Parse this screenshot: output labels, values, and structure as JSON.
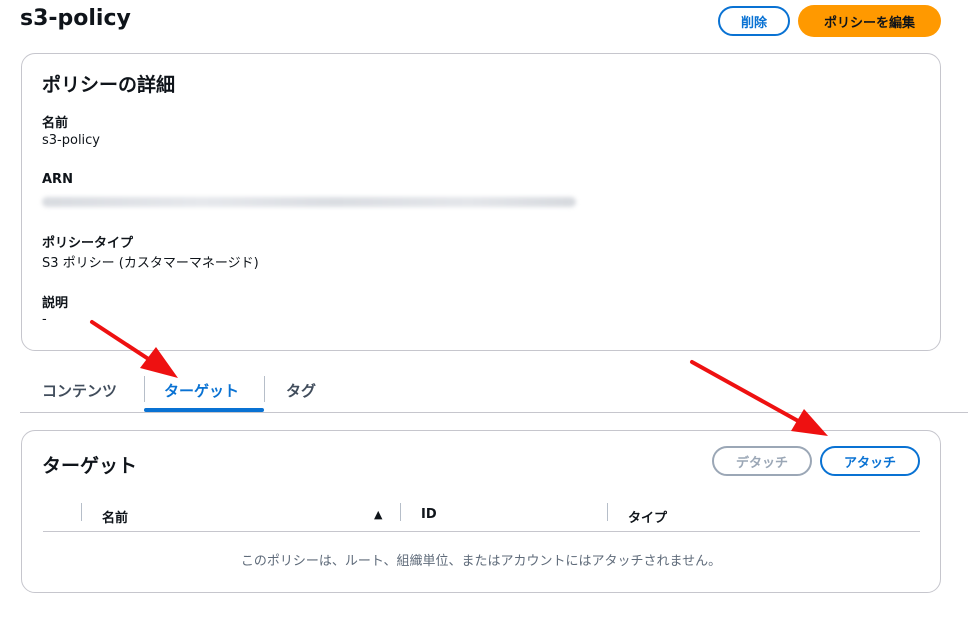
{
  "page": {
    "title": "s3-policy"
  },
  "header_actions": {
    "delete_label": "削除",
    "edit_label": "ポリシーを編集"
  },
  "details": {
    "title": "ポリシーの詳細",
    "fields": [
      {
        "label": "名前",
        "value": "s3-policy"
      },
      {
        "label": "ARN",
        "value": ""
      },
      {
        "label": "ポリシータイプ",
        "value": "S3 ポリシー (カスタマーマネージド)"
      },
      {
        "label": "説明",
        "value": "-"
      }
    ]
  },
  "tabs": [
    {
      "label": "コンテンツ",
      "active": false
    },
    {
      "label": "ターゲット",
      "active": true
    },
    {
      "label": "タグ",
      "active": false
    }
  ],
  "targets": {
    "title": "ターゲット",
    "detach_label": "デタッチ",
    "attach_label": "アタッチ",
    "columns": [
      "名前",
      "ID",
      "タイプ"
    ],
    "sort_indicator": "▲",
    "empty_message": "このポリシーは、ルート、組織単位、またはアカウントにはアタッチされません。"
  },
  "colors": {
    "accent": "#0972d3",
    "primary": "#ff9900",
    "annotation": "#ee1111"
  }
}
